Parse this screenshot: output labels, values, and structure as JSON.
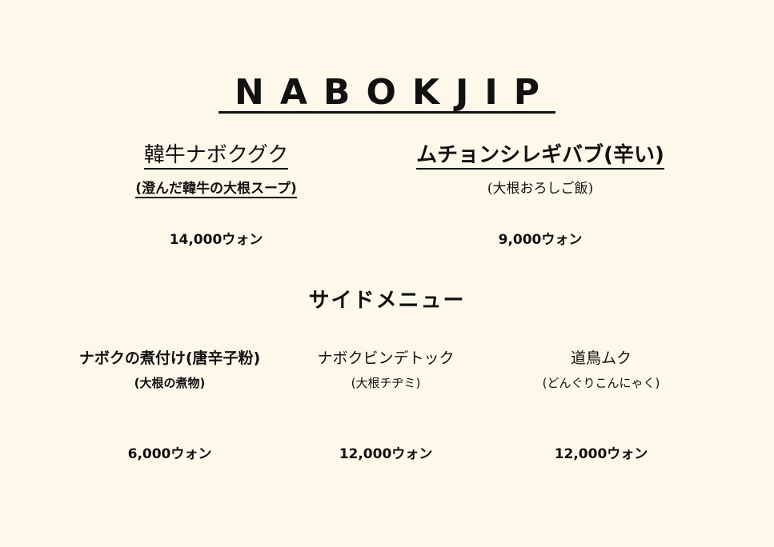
{
  "brand": "NABOKJIP",
  "main_items": [
    {
      "name": "韓牛ナボクグク",
      "desc": "(澄んだ韓牛の大根スープ)",
      "price": "14,000ウォン"
    },
    {
      "name": "ムチョンシレギバブ(辛い)",
      "desc": "(大根おろしご飯)",
      "price": "9,000ウォン"
    }
  ],
  "side_section_title": "サイドメニュー",
  "side_items": [
    {
      "name": "ナボクの煮付け(唐辛子粉)",
      "desc": "(大根の煮物)",
      "price": "6,000ウォン"
    },
    {
      "name": "ナボクビンデトック",
      "desc": "(大根チヂミ)",
      "price": "12,000ウォン"
    },
    {
      "name": "道鳥ムク",
      "desc": "(どんぐりこんにゃく)",
      "price": "12,000ウォン"
    }
  ]
}
